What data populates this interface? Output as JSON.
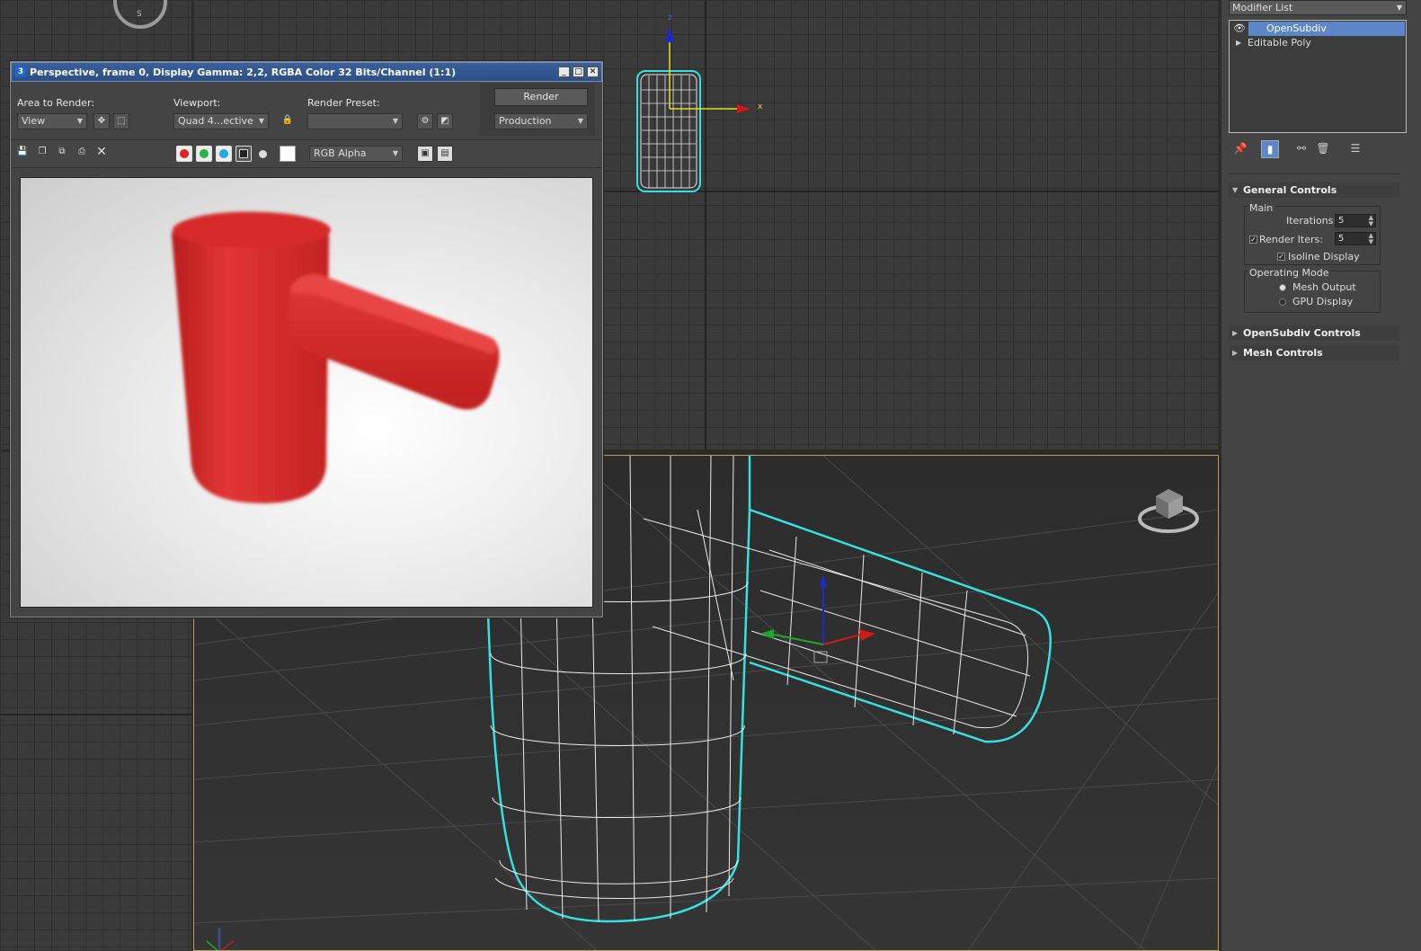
{
  "render_window": {
    "title": "Perspective, frame 0, Display Gamma: 2,2, RGBA Color 32 Bits/Channel (1:1)",
    "app_icon": "3",
    "area_to_render_label": "Area to Render:",
    "area_to_render_value": "View",
    "viewport_label": "Viewport:",
    "viewport_value": "Quad 4...ective",
    "render_preset_label": "Render Preset:",
    "render_preset_value": "",
    "render_button": "Render",
    "production_value": "Production",
    "channel_value": "RGB Alpha",
    "colors": {
      "red": "#e02424",
      "green": "#2db34a",
      "blue": "#22a9e0",
      "object": "#d42a2a"
    }
  },
  "command_panel": {
    "modifier_list_label": "Modifier List",
    "stack": [
      {
        "name": "OpenSubdiv",
        "selected": true,
        "icon": "eye-icon"
      },
      {
        "name": "Editable Poly",
        "selected": false,
        "icon": "expand-arrow-icon"
      }
    ],
    "general_controls": {
      "title": "General Controls",
      "main_group": "Main",
      "iterations_label": "Iterations:",
      "iterations_value": "5",
      "render_iters_label": "Render Iters:",
      "render_iters_value": "5",
      "render_iters_checked": true,
      "isoline_label": "Isoline Display",
      "isoline_checked": true,
      "operating_mode_group": "Operating Mode",
      "mesh_output_label": "Mesh Output",
      "gpu_display_label": "GPU Display",
      "selected_mode": "Mesh Output"
    },
    "rollouts": [
      "OpenSubdiv Controls",
      "Mesh Controls"
    ]
  },
  "viewports": {
    "gizmo_x_label": "x",
    "gizmo_z_label": "z",
    "compass_label": "S",
    "selection_color": "#37e0e0"
  }
}
